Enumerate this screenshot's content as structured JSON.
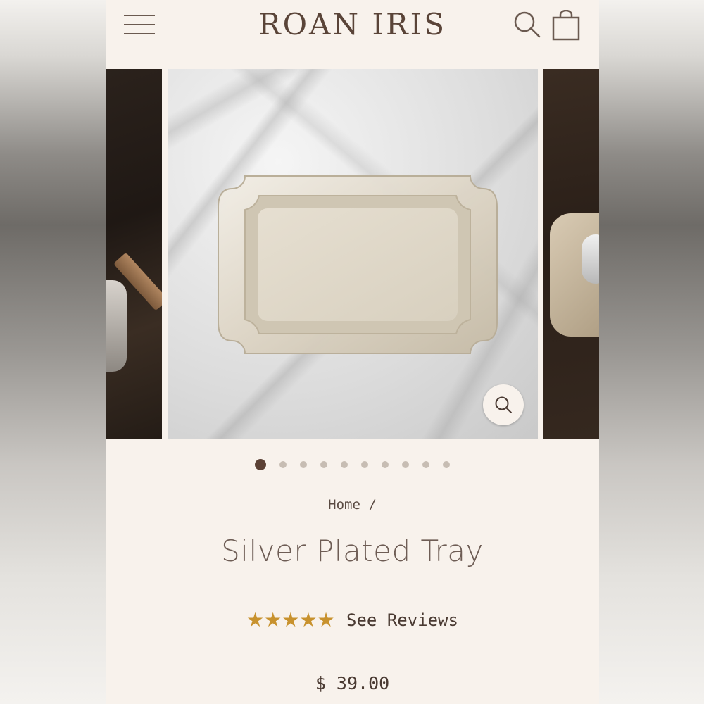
{
  "header": {
    "brand": "ROAN IRIS",
    "menu_icon": "hamburger-menu-icon",
    "search_icon": "search-icon",
    "cart_icon": "shopping-bag-icon"
  },
  "gallery": {
    "slide_count": 10,
    "active_index": 0,
    "zoom_icon": "zoom-magnifier-icon"
  },
  "breadcrumb": {
    "home": "Home",
    "separator": "/"
  },
  "product": {
    "title": "Silver Plated Tray",
    "rating": 5,
    "stars": [
      "★",
      "★",
      "★",
      "★",
      "★"
    ],
    "reviews_label": "See Reviews",
    "price": "$ 39.00"
  },
  "colors": {
    "background": "#f8f2ec",
    "brand_text": "#5a4438",
    "star": "#c8922e",
    "active_dot": "#5b4034",
    "inactive_dot": "#c7bdb3"
  }
}
